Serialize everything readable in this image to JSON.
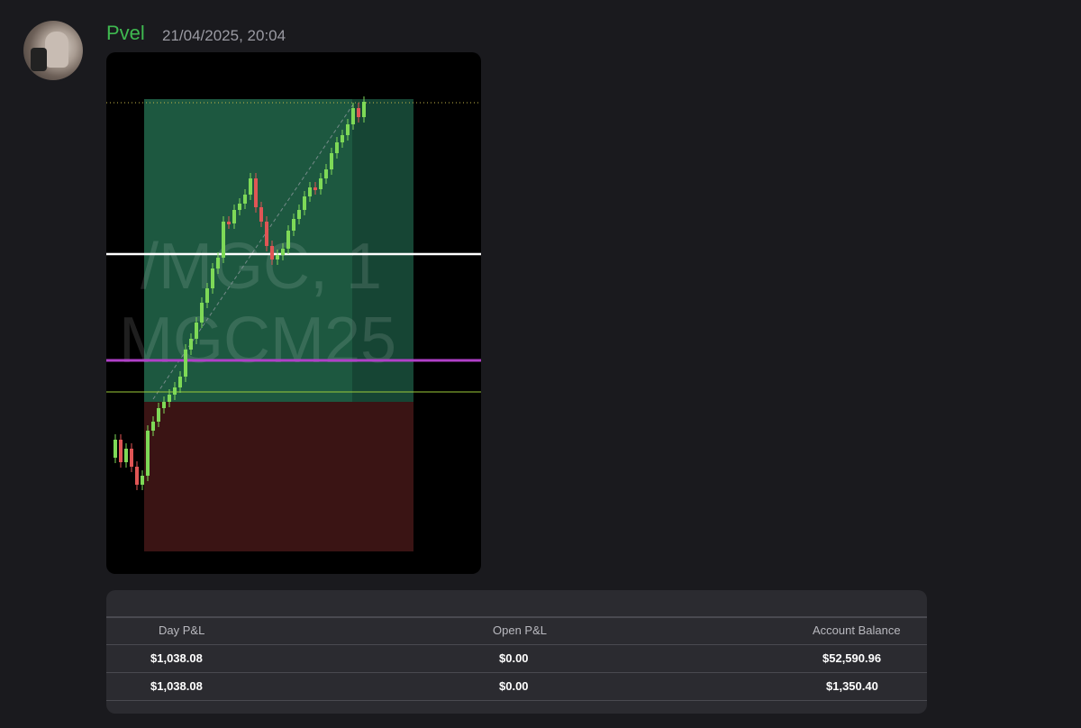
{
  "message": {
    "username": "Pvel",
    "timestamp": "21/04/2025, 20:04"
  },
  "colors": {
    "username": "#3fb950",
    "background": "#1a1a1e",
    "bullish_candle": "#7ed957",
    "bearish_candle": "#e05555",
    "profit_zone": "#1e5c45",
    "loss_zone": "#3a1414",
    "purple_line": "#b040c8",
    "entry_line": "#9ccc3a"
  },
  "chart": {
    "watermark_line1": "/MGC, 1",
    "watermark_line2": "MGCM25"
  },
  "table": {
    "headers": [
      "Day P&L",
      "Open P&L",
      "Account Balance"
    ],
    "rows": [
      [
        "$1,038.08",
        "$0.00",
        "$52,590.96"
      ],
      [
        "$1,038.08",
        "$0.00",
        "$1,350.40"
      ]
    ]
  }
}
